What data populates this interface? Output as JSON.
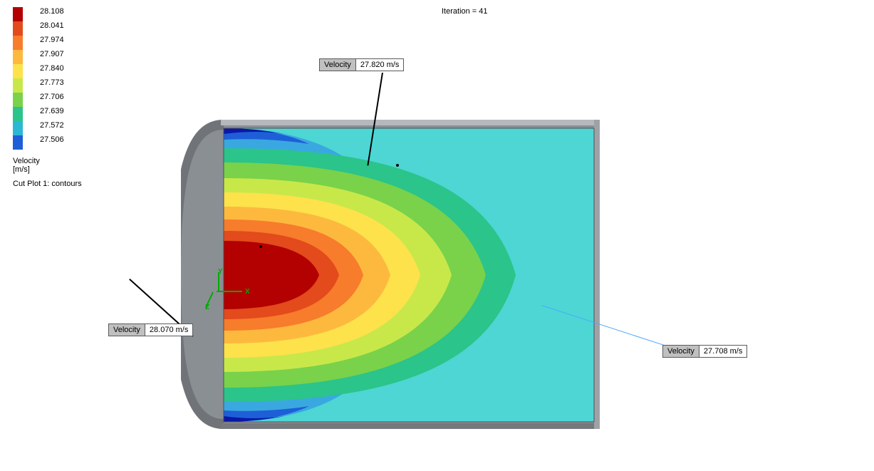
{
  "iteration_label": "Iteration = 41",
  "legend": {
    "title": "Velocity [m/s]",
    "values": [
      "28.108",
      "28.041",
      "27.974",
      "27.907",
      "27.840",
      "27.773",
      "27.706",
      "27.639",
      "27.572",
      "27.506"
    ],
    "colors": [
      "#B30000",
      "#E34A1C",
      "#F77C2B",
      "#FDB93E",
      "#FDE24B",
      "#C8E84A",
      "#79D24A",
      "#2BC48A",
      "#2BB8D4",
      "#1E5FD8",
      "#0A17A8"
    ]
  },
  "cutplot_label": "Cut Plot 1: contours",
  "callouts": {
    "a": {
      "label": "Velocity",
      "value": "27.820 m/s"
    },
    "b": {
      "label": "Velocity",
      "value": "28.070 m/s"
    },
    "c": {
      "label": "Velocity",
      "value": "27.708 m/s"
    }
  },
  "triad": {
    "x": "X",
    "y": "Y",
    "z": "Z"
  },
  "chart_data": {
    "type": "heatmap",
    "title": "Cut Plot 1: contours",
    "quantity": "Velocity",
    "unit": "m/s",
    "value_range": [
      27.506,
      28.108
    ],
    "contour_levels": [
      27.506,
      27.572,
      27.639,
      27.706,
      27.773,
      27.84,
      27.907,
      27.974,
      28.041,
      28.108
    ],
    "probes": [
      {
        "label": "Velocity",
        "value": 27.82,
        "approx_location": "upper-mid green band"
      },
      {
        "label": "Velocity",
        "value": 28.07,
        "approx_location": "center-left red core"
      },
      {
        "label": "Velocity",
        "value": 27.708,
        "approx_location": "right cyan region"
      }
    ],
    "description": "Rectangular duct cross-section with rounded left endcap; velocity highest (~28.1) at left-center core, decreasing outward to ~27.5 at top/bottom-left walls; right side fairly uniform cyan ~27.7."
  }
}
